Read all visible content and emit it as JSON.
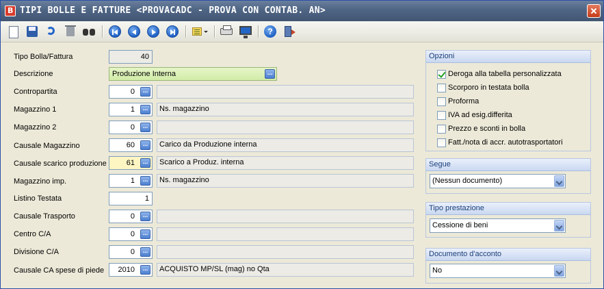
{
  "window": {
    "title": "TIPI BOLLE E FATTURE <PROVACADC - PROVA CON CONTAB. AN>"
  },
  "toolbar": {
    "icons": [
      "new-document-icon",
      "save-icon",
      "undo-icon",
      "delete-icon",
      "search-binoculars-icon",
      "first-record-icon",
      "previous-record-icon",
      "next-record-icon",
      "last-record-icon",
      "list-options-icon",
      "print-icon",
      "preview-screen-icon",
      "help-icon",
      "exit-icon"
    ]
  },
  "form": {
    "tipo_label": "Tipo Bolla/Fattura",
    "tipo_value": "40",
    "descrizione_label": "Descrizione",
    "descrizione_value": "Produzione Interna",
    "contropartita_label": "Contropartita",
    "contropartita_value": "0",
    "contropartita_desc": "",
    "magazzino1_label": "Magazzino 1",
    "magazzino1_value": "1",
    "magazzino1_desc": "Ns. magazzino",
    "magazzino2_label": "Magazzino 2",
    "magazzino2_value": "0",
    "magazzino2_desc": "",
    "causale_mag_label": "Causale Magazzino",
    "causale_mag_value": "60",
    "causale_mag_desc": "Carico da Produzione interna",
    "causale_scarico_label": "Causale scarico produzione",
    "causale_scarico_value": "61",
    "causale_scarico_desc": "Scarico a Produz. interna",
    "magazzino_imp_label": "Magazzino imp.",
    "magazzino_imp_value": "1",
    "magazzino_imp_desc": "Ns. magazzino",
    "listino_label": "Listino Testata",
    "listino_value": "1",
    "causale_trasporto_label": "Causale Trasporto",
    "causale_trasporto_value": "0",
    "causale_trasporto_desc": "",
    "centro_label": "Centro C/A",
    "centro_value": "0",
    "centro_desc": "",
    "divisione_label": "Divisione C/A",
    "divisione_value": "0",
    "divisione_desc": "",
    "causale_ca_label": "Causale CA spese di piede",
    "causale_ca_value": "2010",
    "causale_ca_desc": "ACQUISTO MP/SL (mag) no Qta"
  },
  "opzioni": {
    "title": "Opzioni",
    "items": [
      {
        "label": "Deroga alla tabella personalizzata",
        "checked": true
      },
      {
        "label": "Scorporo in testata bolla",
        "checked": false
      },
      {
        "label": "Proforma",
        "checked": false
      },
      {
        "label": "IVA ad esig.differita",
        "checked": false
      },
      {
        "label": "Prezzo e sconti in bolla",
        "checked": false
      },
      {
        "label": "Fatt./nota di accr. autotrasportatori",
        "checked": false
      }
    ]
  },
  "segue": {
    "title": "Segue",
    "value": "(Nessun documento)"
  },
  "tipo_prestazione": {
    "title": "Tipo prestazione",
    "value": "Cessione di beni"
  },
  "documento_acconto": {
    "title": "Documento d'acconto",
    "value": "No"
  }
}
